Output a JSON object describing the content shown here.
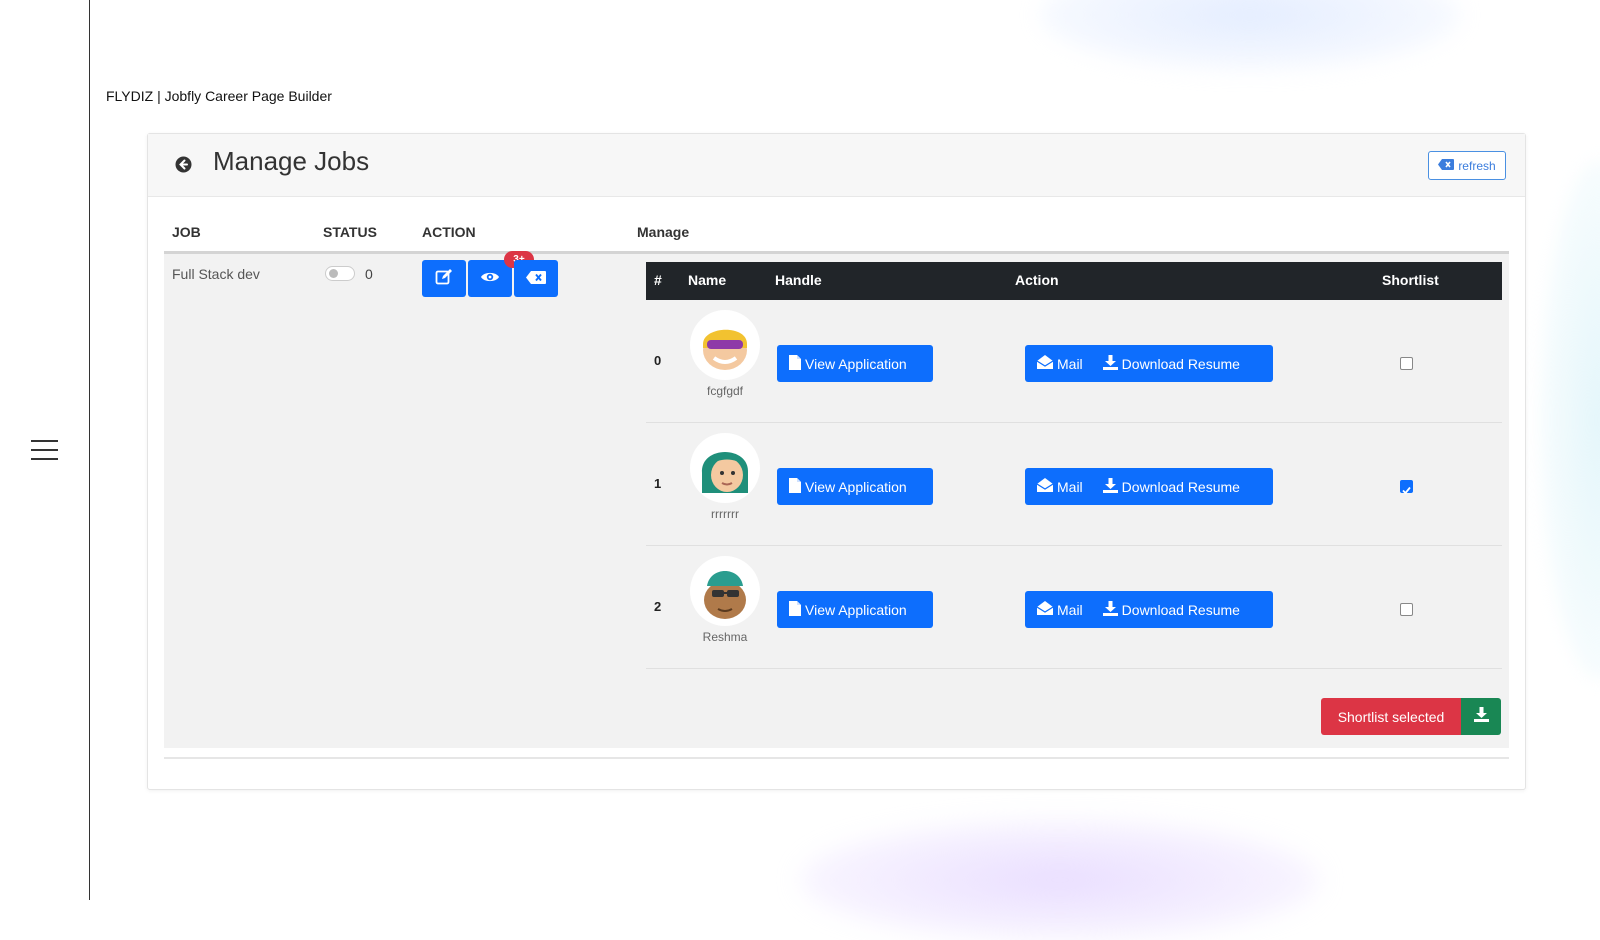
{
  "site": {
    "title": "FLYDIZ | Jobfly Career Page Builder"
  },
  "header": {
    "title": "Manage Jobs",
    "refresh_label": "refresh"
  },
  "columns": {
    "job": "JOB",
    "status": "STATUS",
    "action": "ACTION",
    "manage": "Manage"
  },
  "job": {
    "name": "Full Stack dev",
    "status_count": "0",
    "badge": "3+"
  },
  "applicant_table": {
    "headers": {
      "index": "#",
      "name": "Name",
      "handle": "Handle",
      "action": "Action",
      "shortlist": "Shortlist"
    },
    "rows": [
      {
        "index": "0",
        "name": "fcgfgdf",
        "view_label": "View Application",
        "mail_label": "Mail",
        "download_label": "Download Resume",
        "shortlisted": false
      },
      {
        "index": "1",
        "name": "rrrrrrr",
        "view_label": "View Application",
        "mail_label": "Mail",
        "download_label": "Download Resume",
        "shortlisted": true
      },
      {
        "index": "2",
        "name": "Reshma",
        "view_label": "View Application",
        "mail_label": "Mail",
        "download_label": "Download Resume",
        "shortlisted": false
      }
    ]
  },
  "footer": {
    "shortlist_selected_label": "Shortlist selected"
  },
  "icons": {
    "menu": "hamburger-menu-icon",
    "back": "circle-arrow-left-icon",
    "refresh": "backspace-icon",
    "edit": "edit-icon",
    "view": "eye-icon",
    "delete": "backspace-icon",
    "file": "file-icon",
    "mail": "envelope-open-icon",
    "download": "download-icon"
  },
  "colors": {
    "primary": "#0d6efd",
    "danger": "#dc3545",
    "success": "#198754",
    "table_header": "#212529",
    "row_bg": "#f2f2f2"
  }
}
